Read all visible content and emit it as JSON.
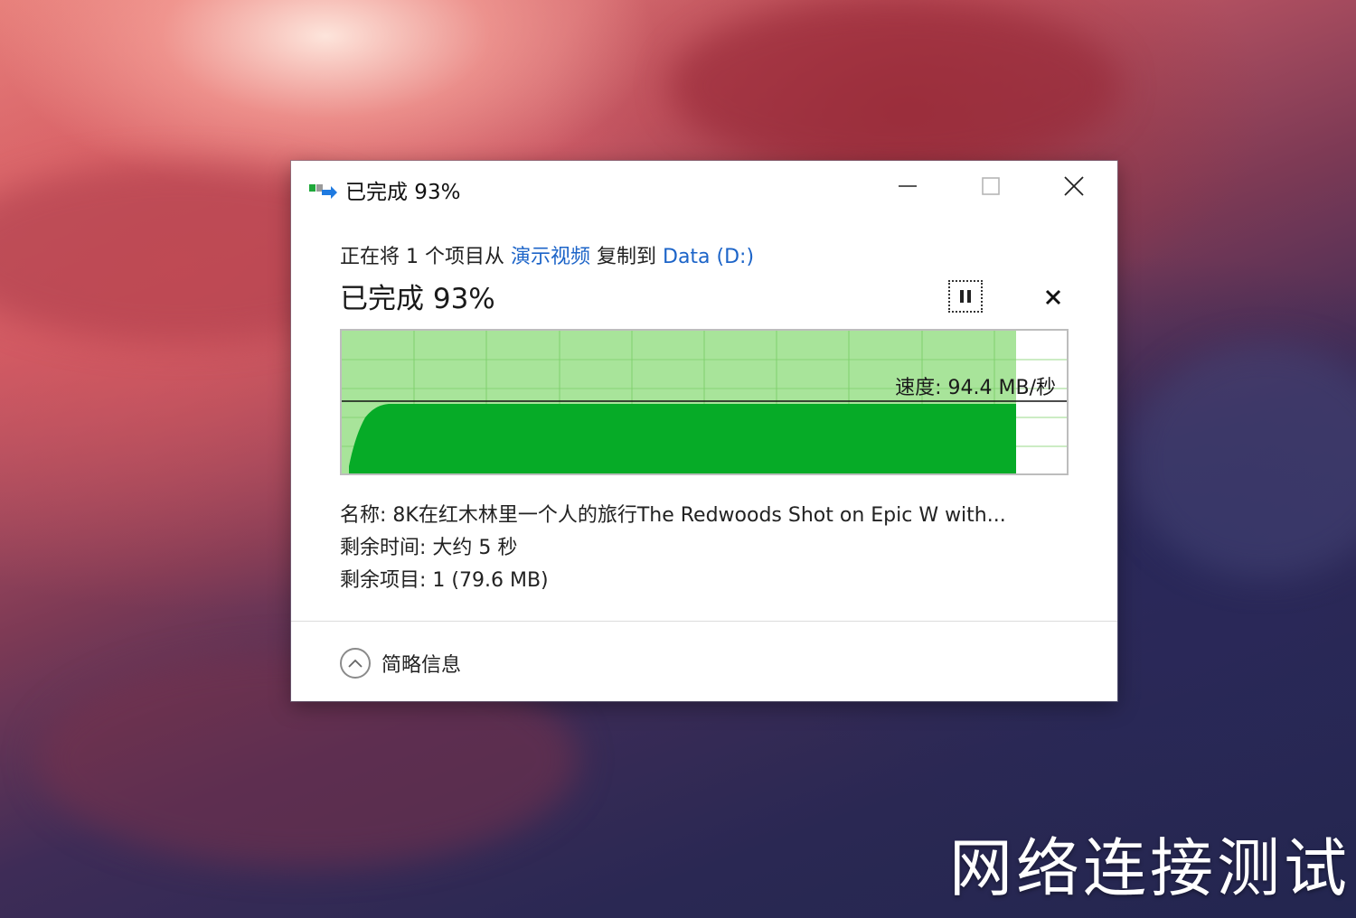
{
  "window": {
    "title": "已完成 93%",
    "icons": {
      "app": "copy-transfer-icon",
      "minimize": "minimize-icon",
      "maximize": "maximize-icon",
      "close": "close-icon"
    }
  },
  "transfer": {
    "prefix": "正在将 1 个项目从 ",
    "source": "演示视频",
    "middle": " 复制到 ",
    "destination": "Data (D:)",
    "heading": "已完成 93%",
    "progress_percent": 93,
    "pause_icon": "pause-icon",
    "cancel_icon": "cancel-icon"
  },
  "speed": {
    "label": "速度: 94.4 MB/秒"
  },
  "details": {
    "name": "名称: 8K在红木林里一个人的旅行The Redwoods Shot on Epic W with...",
    "time_remaining": "剩余时间: 大约 5 秒",
    "items_remaining": "剩余项目: 1 (79.6 MB)"
  },
  "footer": {
    "label": "简略信息",
    "icon": "chevron-up-icon"
  },
  "watermark": {
    "text": "网络连接测试"
  },
  "colors": {
    "progress_fill": "#a8e49a",
    "graph_fill": "#06ab27",
    "link": "#1c64c8",
    "grid": "#7fd06d"
  }
}
